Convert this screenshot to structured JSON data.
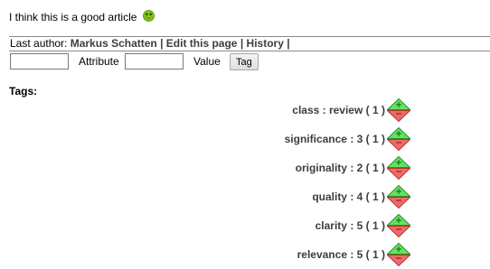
{
  "comment": {
    "text": "I think this is a good article"
  },
  "author_bar": {
    "prefix": "Last author:",
    "author": "Markus Schatten",
    "sep1": "|",
    "edit_link": "Edit this page",
    "sep2": "|",
    "history_link": "History",
    "sep3": "|"
  },
  "tag_form": {
    "attribute_value": "",
    "attribute_label": "Attribute",
    "value_value": "",
    "value_label": "Value",
    "tag_button": "Tag"
  },
  "tags": {
    "heading": "Tags:",
    "items": [
      {
        "label": "class : review ( 1 )"
      },
      {
        "label": "significance : 3 ( 1 )"
      },
      {
        "label": "originality : 2 ( 1 )"
      },
      {
        "label": "quality : 4 ( 1 )"
      },
      {
        "label": "clarity : 5 ( 1 )"
      },
      {
        "label": "relevance : 5 ( 1 )"
      }
    ]
  },
  "colors": {
    "vote_up_fill": "#5ce65c",
    "vote_down_fill": "#f06a6a",
    "smiley": "#7ac70c"
  }
}
